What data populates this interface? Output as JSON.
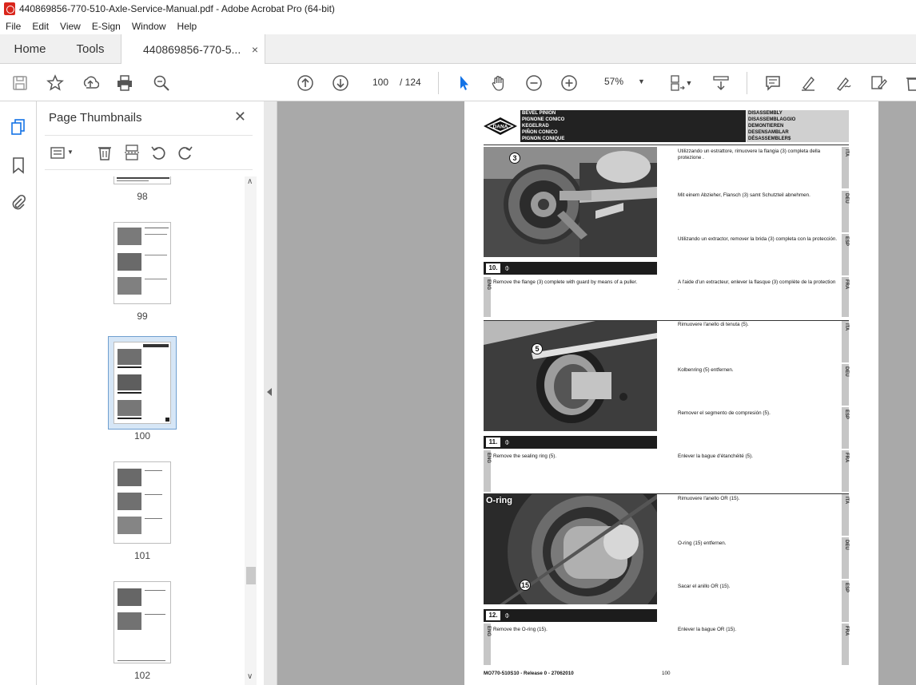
{
  "window": {
    "title": "440869856-770-510-Axle-Service-Manual.pdf - Adobe Acrobat Pro (64-bit)"
  },
  "menu": [
    "File",
    "Edit",
    "View",
    "E-Sign",
    "Window",
    "Help"
  ],
  "tabs": {
    "home": "Home",
    "tools": "Tools",
    "document": "440869856-770-5...",
    "close_glyph": "×"
  },
  "toolbar": {
    "page_current": "100",
    "page_total": "/ 124",
    "zoom": "57%"
  },
  "thumbnails": {
    "title": "Page Thumbnails",
    "close_glyph": "✕",
    "pages": [
      {
        "label": "98",
        "selected": false
      },
      {
        "label": "99",
        "selected": false
      },
      {
        "label": "100",
        "selected": true
      },
      {
        "label": "101",
        "selected": false
      },
      {
        "label": "102",
        "selected": false
      }
    ]
  },
  "document_page": {
    "logo": "DANA",
    "header_left": [
      "BEVEL PINION",
      "PIGNONE CONICO",
      "KEGELRAD",
      "PIÑON CONICO",
      "PIGNON CONIQUE"
    ],
    "header_right": [
      "DISASSEMBLY",
      "DISASSEMBLAGGIO",
      "DEMONTIEREN",
      "DESENSAMBLAR",
      "DÉSASSEMBLER$"
    ],
    "steps": [
      {
        "number": "10.",
        "callouts": [
          "3"
        ],
        "ita": "Utilizzando un estrattore, rimuovere la flangia (3) completa della protezione .",
        "deu": "Mit einem Abzieher, Flansch (3) samt Schutzteil abnehmen.",
        "esp": "Utilizando un extractor, remover la brida (3) completa con la protección.",
        "eng": "Remove the flange (3) complete with guard by means of a puller.",
        "fra": "A l'aide d'un extracteur, enlever la flasque (3) complète de la protection ."
      },
      {
        "number": "11.",
        "callouts": [
          "5"
        ],
        "ita": "Rimuovere l'anello di tenuta (5).",
        "deu": "Kolbenring (5) entfernen.",
        "esp": "Remover el segmento de compresión (5).",
        "eng": "Remove the sealing ring (5).",
        "fra": "Enlever la bague d'étanchéité (5)."
      },
      {
        "number": "12.",
        "callouts": [
          "O-ring",
          "15"
        ],
        "ita": "Rimuovere l'anello OR (15).",
        "deu": "O-ring (15) entfernen.",
        "esp": "Sacar el anillo OR (15).",
        "eng": "Remove the O-ring (15).",
        "fra": "Enlever la bague OR (15)."
      }
    ],
    "lang_labels": {
      "ita": "ITA",
      "deu": "DEU",
      "esp": "ESP",
      "eng": "ENG",
      "fra": "FRA"
    },
    "step_icon": "⌽",
    "footer_left": "MO770-510S10 - Release 0 - 27062010",
    "footer_page": "100"
  },
  "colors": {
    "accent_blue": "#1473e6",
    "selection_fill": "#d6e6f6",
    "doc_bg": "#a9a9a9"
  }
}
